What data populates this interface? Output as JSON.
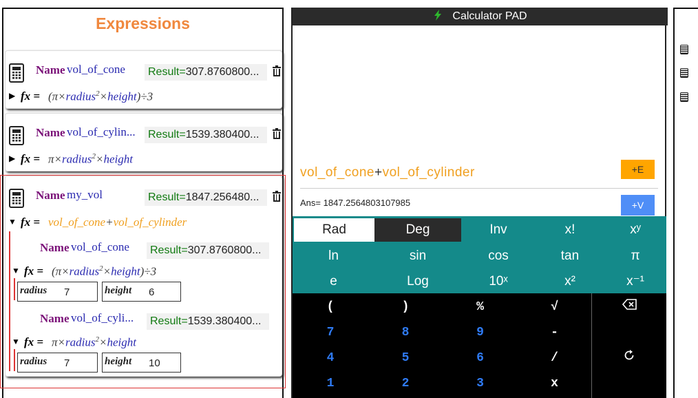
{
  "expressions_panel": {
    "title": "Expressions",
    "name_label": "Name",
    "result_label": "Result=",
    "fx_label": "fx",
    "cards": [
      {
        "name": "vol_of_cone",
        "result": "307.8760800...",
        "formula": "(π×radius²×height)÷3"
      },
      {
        "name": "vol_of_cylin...",
        "result": "1539.380400...",
        "formula": "π×radius²×height"
      },
      {
        "name": "my_vol",
        "result": "1847.256480...",
        "formula": "vol_of_cone+vol_of_cylinder",
        "children": [
          {
            "name": "vol_of_cone",
            "result": "307.8760800...",
            "formula": "(π×radius²×height)÷3",
            "inputs": [
              {
                "label": "radius",
                "value": "7"
              },
              {
                "label": "height",
                "value": "6"
              }
            ]
          },
          {
            "name": "vol_of_cyli...",
            "result": "1539.380400...",
            "formula": "π×radius²×height",
            "inputs": [
              {
                "label": "radius",
                "value": "7"
              },
              {
                "label": "height",
                "value": "10"
              }
            ]
          }
        ]
      }
    ]
  },
  "calculator": {
    "title": "Calculator PAD",
    "expression_a": "vol_of_cone",
    "expression_op": "+",
    "expression_b": "vol_of_cylinder",
    "ans": "Ans= 1847.2564803107985",
    "btn_add_expression": "+E",
    "btn_add_variable": "+V",
    "sci_keys": [
      [
        "Rad",
        "Deg",
        "Inv",
        "x!",
        "xʸ"
      ],
      [
        "ln",
        "sin",
        "cos",
        "tan",
        "π"
      ],
      [
        "e",
        "Log",
        "10ˣ",
        "x²",
        "x⁻¹"
      ]
    ],
    "num_keys": [
      [
        "(",
        ")",
        "%",
        "√"
      ],
      [
        "7",
        "8",
        "9",
        "-"
      ],
      [
        "4",
        "5",
        "6",
        "/"
      ],
      [
        "1",
        "2",
        "3",
        "x"
      ]
    ],
    "colors": {
      "teal": "#148a8a",
      "orange": "#ffa500",
      "blue": "#4f8ef7",
      "digit": "#2f7bf5"
    }
  }
}
